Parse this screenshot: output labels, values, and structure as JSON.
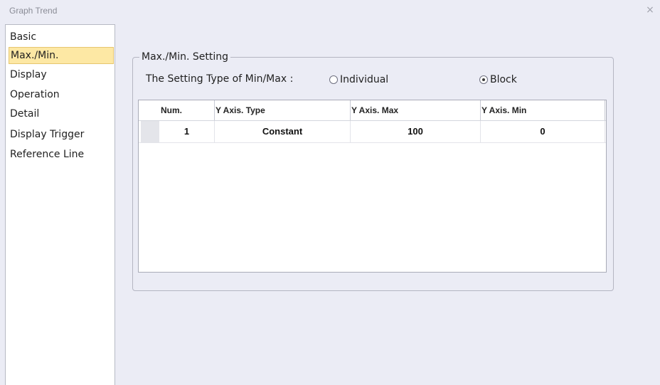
{
  "window": {
    "title": "Graph Trend",
    "close_glyph": "×"
  },
  "nav": {
    "items": [
      {
        "label": "Basic"
      },
      {
        "label": "Max./Min."
      },
      {
        "label": "Display"
      },
      {
        "label": "Operation"
      },
      {
        "label": "Detail"
      },
      {
        "label": "Display Trigger"
      },
      {
        "label": "Reference Line"
      }
    ],
    "selected": "Max./Min."
  },
  "settings": {
    "group_title": "Max./Min. Setting",
    "type_label": "The Setting Type of Min/Max :",
    "options": [
      {
        "label": "Individual",
        "checked": false
      },
      {
        "label": "Block",
        "checked": true
      }
    ]
  },
  "table": {
    "columns": [
      "Num.",
      "Y Axis. Type",
      "Y Axis. Max",
      "Y Axis. Min"
    ],
    "rows": [
      {
        "num": "1",
        "type": "Constant",
        "max": "100",
        "min": "0"
      }
    ]
  },
  "colors": {
    "selection_bg": "#fde8a4",
    "window_bg": "#ebecf5"
  }
}
